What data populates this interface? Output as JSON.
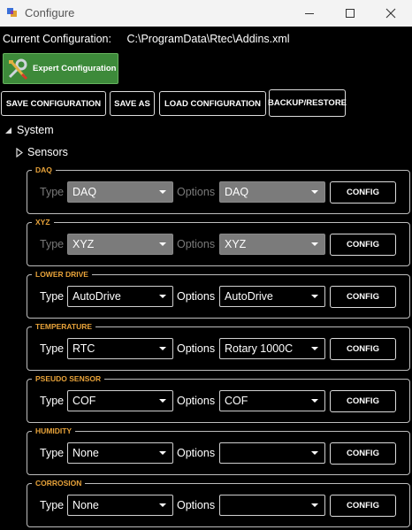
{
  "window": {
    "title": "Configure"
  },
  "current_configuration": {
    "label": "Current Configuration:",
    "path": "C:\\ProgramData\\Rtec\\Addins.xml"
  },
  "expert_button": {
    "label": "Expert Configuration"
  },
  "toolbar": {
    "save_configuration": "SAVE CONFIGURATION",
    "save_as": "SAVE AS",
    "load_configuration": "LOAD CONFIGURATION",
    "backup_restore": "BACKUP/RESTORE"
  },
  "tree": {
    "system": "System",
    "sensors": "Sensors"
  },
  "labels": {
    "type": "Type",
    "options": "Options",
    "config": "CONFIG"
  },
  "groups": [
    {
      "title": "DAQ",
      "type": "DAQ",
      "options": "DAQ",
      "disabled": true
    },
    {
      "title": "XYZ",
      "type": "XYZ",
      "options": "XYZ",
      "disabled": true
    },
    {
      "title": "LOWER DRIVE",
      "type": "AutoDrive",
      "options": "AutoDrive",
      "disabled": false
    },
    {
      "title": "TEMPERATURE",
      "type": "RTC",
      "options": "Rotary 1000C",
      "disabled": false
    },
    {
      "title": "PSEUDO SENSOR",
      "type": "COF",
      "options": "COF",
      "disabled": false
    },
    {
      "title": "HUMIDITY",
      "type": "None",
      "options": "",
      "disabled": false
    },
    {
      "title": "CORROSION",
      "type": "None",
      "options": "",
      "disabled": false
    }
  ],
  "colors": {
    "group_title": "#e8a33a",
    "expert_button": "#3d8a3a",
    "disabled_combo": "#7b7b7b"
  }
}
